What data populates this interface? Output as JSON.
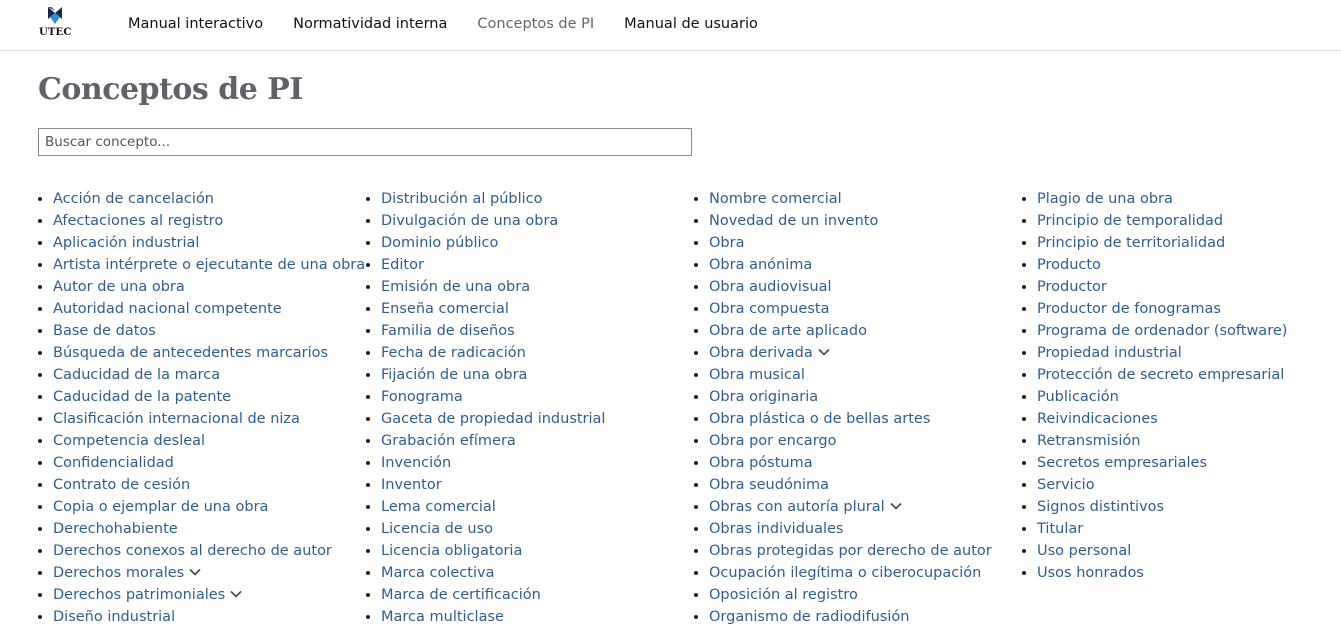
{
  "header": {
    "logo_text": "UTEC",
    "nav": [
      {
        "label": "Manual interactivo",
        "active": false
      },
      {
        "label": "Normatividad interna",
        "active": false
      },
      {
        "label": "Conceptos de PI",
        "active": true
      },
      {
        "label": "Manual de usuario",
        "active": false
      }
    ]
  },
  "page": {
    "title": "Conceptos de PI",
    "search_placeholder": "Buscar concepto..."
  },
  "columns": [
    [
      {
        "label": "Acción de cancelación"
      },
      {
        "label": "Afectaciones al registro"
      },
      {
        "label": "Aplicación industrial"
      },
      {
        "label": "Artista intérprete o ejecutante de una obra"
      },
      {
        "label": "Autor de una obra"
      },
      {
        "label": "Autoridad nacional competente"
      },
      {
        "label": "Base de datos"
      },
      {
        "label": "Búsqueda de antecedentes marcarios"
      },
      {
        "label": "Caducidad de la marca"
      },
      {
        "label": "Caducidad de la patente"
      },
      {
        "label": "Clasificación internacional de niza"
      },
      {
        "label": "Competencia desleal"
      },
      {
        "label": "Confidencialidad"
      },
      {
        "label": "Contrato de cesión"
      },
      {
        "label": "Copia o ejemplar de una obra"
      },
      {
        "label": "Derechohabiente"
      },
      {
        "label": "Derechos conexos al derecho de autor"
      },
      {
        "label": "Derechos morales",
        "expandable": true
      },
      {
        "label": "Derechos patrimoniales",
        "expandable": true
      },
      {
        "label": "Diseño industrial"
      }
    ],
    [
      {
        "label": "Distribución al público"
      },
      {
        "label": "Divulgación de una obra"
      },
      {
        "label": "Dominio público"
      },
      {
        "label": "Editor"
      },
      {
        "label": "Emisión de una obra"
      },
      {
        "label": "Enseña comercial"
      },
      {
        "label": "Familia de diseños"
      },
      {
        "label": "Fecha de radicación"
      },
      {
        "label": "Fijación de una obra"
      },
      {
        "label": "Fonograma"
      },
      {
        "label": "Gaceta de propiedad industrial"
      },
      {
        "label": "Grabación efímera"
      },
      {
        "label": "Invención"
      },
      {
        "label": "Inventor"
      },
      {
        "label": "Lema comercial"
      },
      {
        "label": "Licencia de uso"
      },
      {
        "label": "Licencia obligatoria"
      },
      {
        "label": "Marca colectiva"
      },
      {
        "label": "Marca de certificación"
      },
      {
        "label": "Marca multiclase"
      }
    ],
    [
      {
        "label": "Nombre comercial"
      },
      {
        "label": "Novedad de un invento"
      },
      {
        "label": "Obra"
      },
      {
        "label": "Obra anónima"
      },
      {
        "label": "Obra audiovisual"
      },
      {
        "label": "Obra compuesta"
      },
      {
        "label": "Obra de arte aplicado"
      },
      {
        "label": "Obra derivada",
        "expandable": true
      },
      {
        "label": "Obra musical"
      },
      {
        "label": "Obra originaria"
      },
      {
        "label": "Obra plástica o de bellas artes"
      },
      {
        "label": "Obra por encargo"
      },
      {
        "label": "Obra póstuma"
      },
      {
        "label": "Obra seudónima"
      },
      {
        "label": "Obras con autoría plural",
        "expandable": true
      },
      {
        "label": "Obras individuales"
      },
      {
        "label": "Obras protegidas por derecho de autor"
      },
      {
        "label": "Ocupación ilegítima o ciberocupación"
      },
      {
        "label": "Oposición al registro"
      },
      {
        "label": "Organismo de radiodifusión"
      }
    ],
    [
      {
        "label": "Plagio de una obra"
      },
      {
        "label": "Principio de temporalidad"
      },
      {
        "label": "Principio de territorialidad"
      },
      {
        "label": "Producto"
      },
      {
        "label": "Productor"
      },
      {
        "label": "Productor de fonogramas"
      },
      {
        "label": "Programa de ordenador (software)"
      },
      {
        "label": "Propiedad industrial"
      },
      {
        "label": "Protección de secreto empresarial"
      },
      {
        "label": "Publicación"
      },
      {
        "label": "Reivindicaciones"
      },
      {
        "label": "Retransmisión"
      },
      {
        "label": "Secretos empresariales"
      },
      {
        "label": "Servicio"
      },
      {
        "label": "Signos distintivos"
      },
      {
        "label": "Titular"
      },
      {
        "label": "Uso personal"
      },
      {
        "label": "Usos honrados"
      }
    ]
  ]
}
